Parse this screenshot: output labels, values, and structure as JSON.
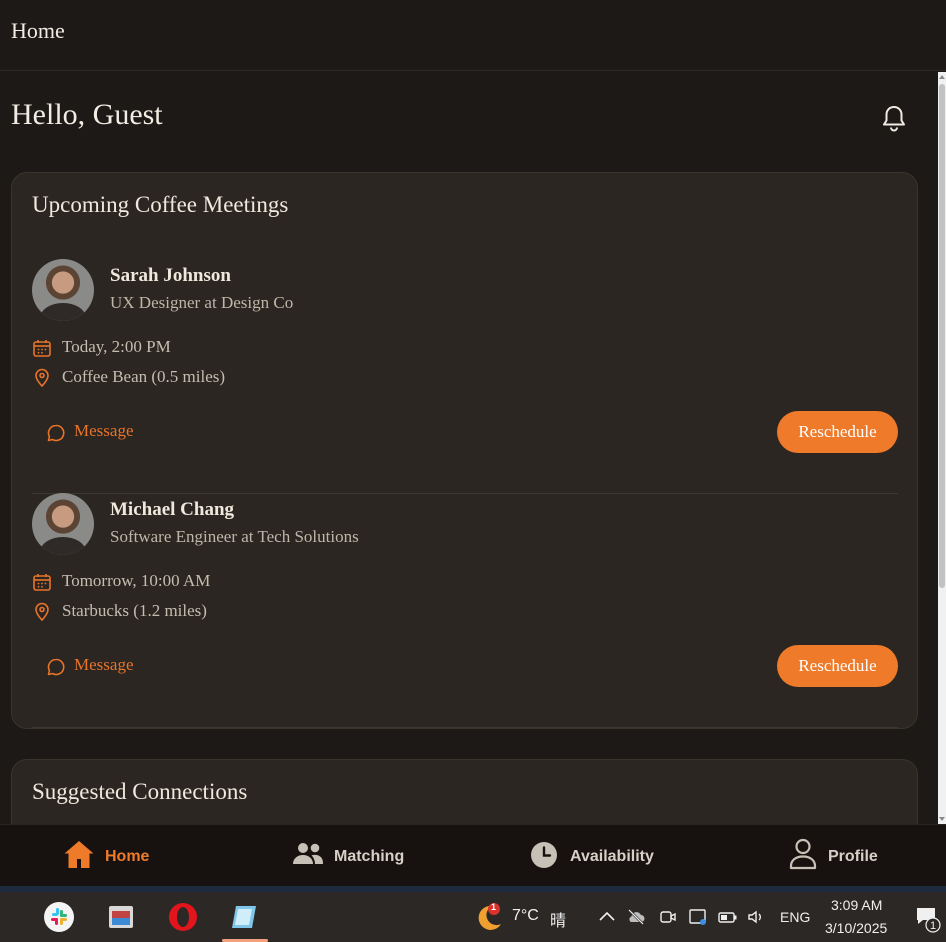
{
  "header": {
    "title": "Home"
  },
  "greeting": "Hello, Guest",
  "meetings_card": {
    "title": "Upcoming Coffee Meetings",
    "meetings": [
      {
        "name": "Sarah Johnson",
        "role": "UX Designer at Design Co",
        "time": "Today, 2:00 PM",
        "location": "Coffee Bean (0.5 miles)",
        "message_label": "Message",
        "reschedule_label": "Reschedule"
      },
      {
        "name": "Michael Chang",
        "role": "Software Engineer at Tech Solutions",
        "time": "Tomorrow, 10:00 AM",
        "location": "Starbucks (1.2 miles)",
        "message_label": "Message",
        "reschedule_label": "Reschedule"
      }
    ]
  },
  "suggested_card": {
    "title": "Suggested Connections"
  },
  "nav": {
    "items": [
      {
        "label": "Home",
        "icon": "home-icon",
        "active": true
      },
      {
        "label": "Matching",
        "icon": "people-icon",
        "active": false
      },
      {
        "label": "Availability",
        "icon": "clock-icon",
        "active": false
      },
      {
        "label": "Profile",
        "icon": "user-icon",
        "active": false
      }
    ]
  },
  "colors": {
    "accent": "#ee7a2a",
    "background": "#1c1916",
    "card": "#2b2621"
  },
  "taskbar": {
    "weather_badge": "1",
    "temperature": "7°C",
    "condition": "晴",
    "language": "ENG",
    "time": "3:09 AM",
    "date": "3/10/2025",
    "notification_count": "1"
  }
}
